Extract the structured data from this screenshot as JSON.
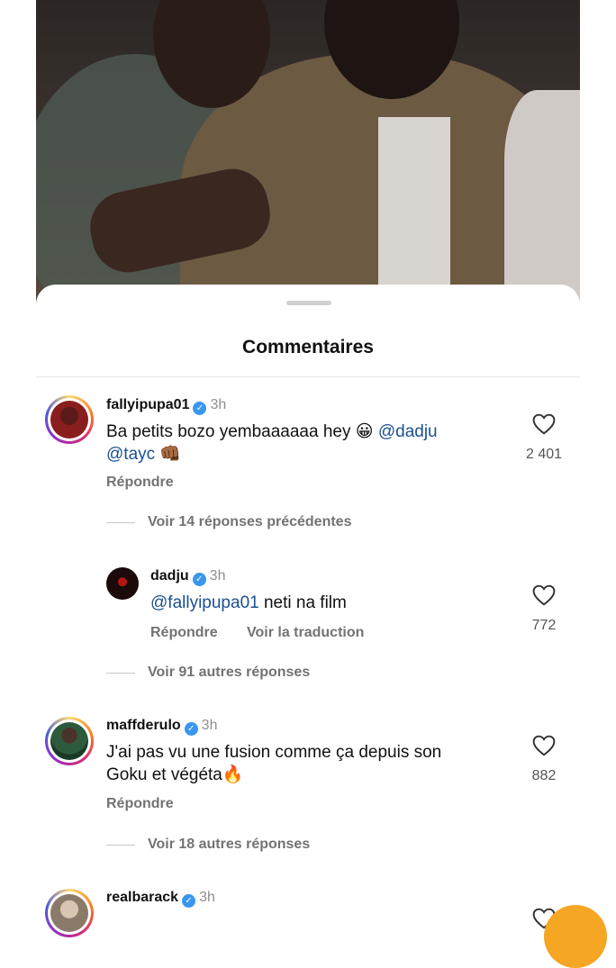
{
  "sheet": {
    "title": "Commentaires"
  },
  "comments": [
    {
      "username": "fallyipupa01",
      "time": "3h",
      "text_pre": "Ba petits bozo yembaaaaaa hey 😀 ",
      "mention1": "@dadju",
      "mention2": "@tayc",
      "emoji_end": "👊🏾",
      "reply_label": "Répondre",
      "likes": "2 401",
      "view_replies": "Voir 14 réponses précédentes"
    },
    {
      "username": "dadju",
      "time": "3h",
      "mention": "@fallyipupa01",
      "text": " neti na film",
      "reply_label": "Répondre",
      "translate_label": "Voir la traduction",
      "likes": "772",
      "view_replies": "Voir 91 autres réponses"
    },
    {
      "username": "maffderulo",
      "time": "3h",
      "text_line1": "J'ai pas vu une fusion comme ça depuis son",
      "text_line2": "Goku et végéta🔥",
      "reply_label": "Répondre",
      "likes": "882",
      "view_replies": "Voir 18 autres réponses"
    },
    {
      "username": "realbarack",
      "time": "3h"
    }
  ],
  "icons": {
    "verified": "verified-badge-icon",
    "like": "heart-outline-icon"
  },
  "colors": {
    "verified": "#3897f0",
    "mention": "#1d4f91",
    "muted": "#737373"
  }
}
